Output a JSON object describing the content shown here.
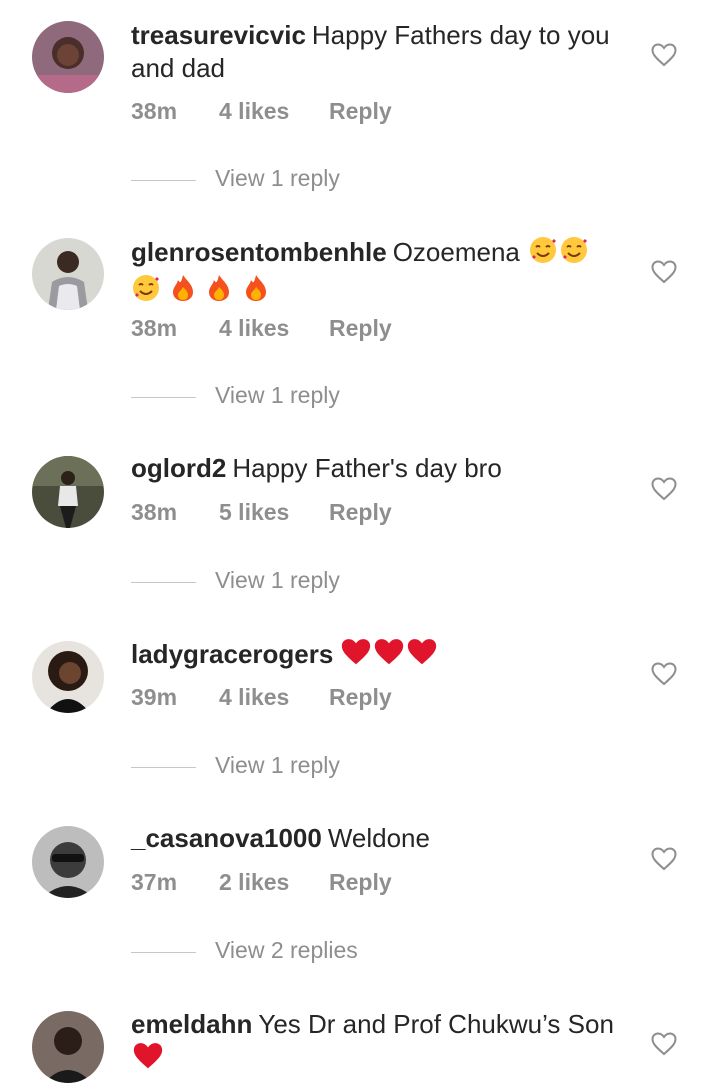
{
  "comments": [
    {
      "username": "treasurevicvic",
      "text": "Happy Fathers day to you and dad",
      "time": "38m",
      "likes": "4 likes",
      "reply": "Reply",
      "view_replies": "View 1 reply",
      "avatar_color": "#8a5a6f"
    },
    {
      "username": "glenrosentombenhle",
      "text": "Ozoemena",
      "emojis": [
        "smiling-face-with-hearts",
        "smiling-face-with-hearts",
        "smiling-face-with-hearts",
        "fire",
        "fire",
        "fire"
      ],
      "time": "38m",
      "likes": "4 likes",
      "reply": "Reply",
      "view_replies": "View 1 reply",
      "avatar_color": "#c9c9c4"
    },
    {
      "username": "oglord2",
      "text": "Happy Father's day bro",
      "time": "38m",
      "likes": "5 likes",
      "reply": "Reply",
      "view_replies": "View 1 reply",
      "avatar_color": "#4a4d3c"
    },
    {
      "username": "ladygracerogers",
      "text": "",
      "emojis": [
        "red-heart",
        "red-heart",
        "red-heart"
      ],
      "time": "39m",
      "likes": "4 likes",
      "reply": "Reply",
      "view_replies": "View 1 reply",
      "avatar_color": "#3a2b26"
    },
    {
      "username": "_casanova1000",
      "text": "Weldone",
      "time": "37m",
      "likes": "2 likes",
      "reply": "Reply",
      "view_replies": "View 2 replies",
      "avatar_color": "#6b6b6b"
    },
    {
      "username": "emeldahn",
      "text": "Yes Dr and Prof Chukwu’s Son",
      "emojis": [
        "red-heart"
      ],
      "time": "",
      "likes": "",
      "reply": "",
      "view_replies": "",
      "avatar_color": "#5c4a45"
    }
  ],
  "colors": {
    "text": "#262626",
    "meta": "#8e8e8e",
    "divider": "#c7c7c7",
    "heart_red": "#e0245e"
  },
  "icons": {
    "like": "heart-outline-icon"
  }
}
